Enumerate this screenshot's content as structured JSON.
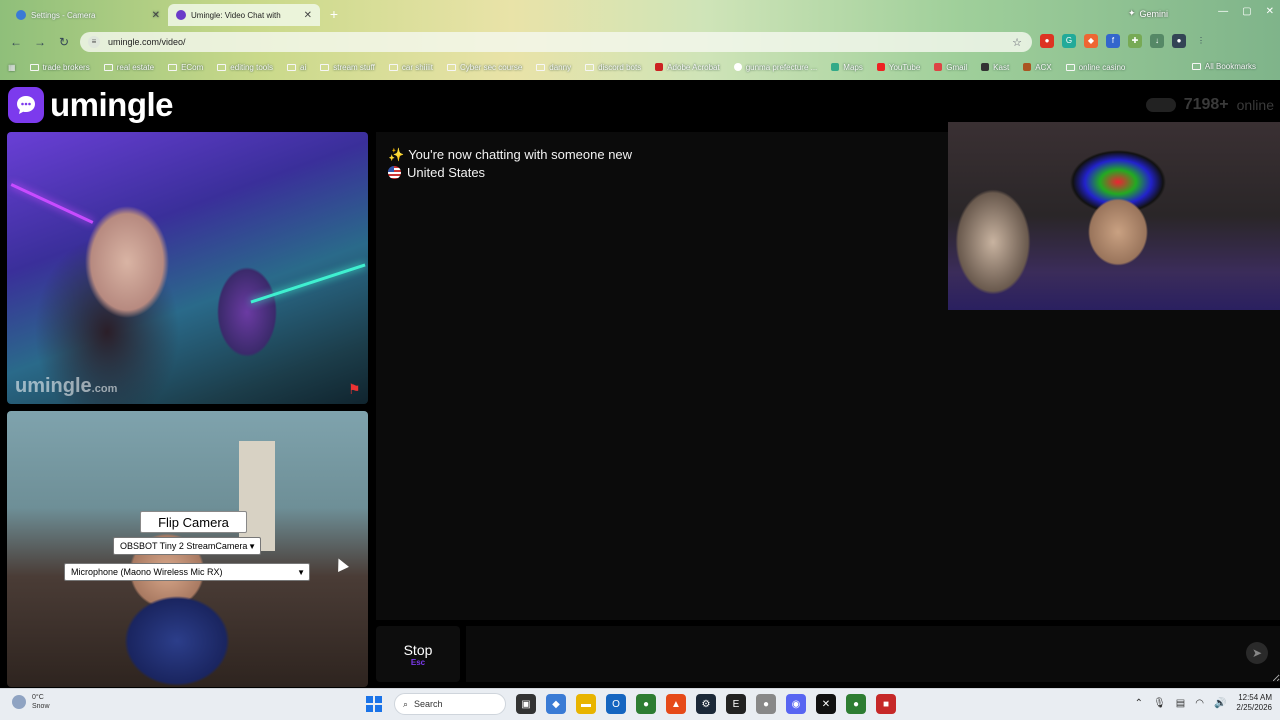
{
  "browser": {
    "tabs": [
      {
        "title": "Settings - Camera",
        "active": false
      },
      {
        "title": "Umingle: Video Chat with",
        "active": true
      }
    ],
    "new_tab": "+",
    "gemini_label": "Gemini",
    "url": "umingle.com/video/",
    "bookmarks": [
      "trade brokers",
      "real estate",
      "ECom",
      "editing tools",
      "ai",
      "stream stuff",
      "car shiiiit",
      "Cyber sec course",
      "danny",
      "discord bots",
      "Adobe Acrobat",
      "gunma prefecture ...",
      "Maps",
      "YouTube",
      "Gmail",
      "Kast",
      "ACX",
      "online casino"
    ],
    "all_bookmarks": "All Bookmarks"
  },
  "site": {
    "logo_text": "umingle",
    "online_count": "7198+",
    "online_label": "online",
    "watermark": "umingle",
    "watermark_suffix": ".com"
  },
  "controls": {
    "flip_camera": "Flip Camera",
    "camera_select": "OBSBOT Tiny 2 StreamCamera",
    "microphone_select": "Microphone (Maono Wireless Mic RX)"
  },
  "chat": {
    "status_message": "You're now chatting with someone new",
    "country": "United States",
    "stop_label": "Stop",
    "stop_key": "Esc"
  },
  "taskbar": {
    "temperature": "0°C",
    "weather": "Snow",
    "search_placeholder": "Search",
    "time": "12:54 AM",
    "date": "2/25/2026"
  },
  "colors": {
    "brand_purple": "#7c3aed",
    "page_bg": "#000000",
    "chat_bg": "#0b0b0b"
  }
}
